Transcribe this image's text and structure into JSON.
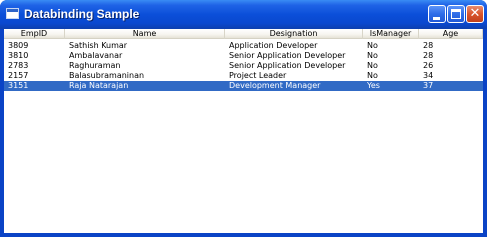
{
  "window": {
    "title": "Databinding Sample",
    "accent": "#0a43c6",
    "selection_color": "#316ac5"
  },
  "controls": {
    "minimize_icon": "minimize-icon",
    "maximize_icon": "maximize-icon",
    "close_icon": "close-icon",
    "close_glyph": "✕"
  },
  "table": {
    "columns": [
      "EmpID",
      "Name",
      "Designation",
      "IsManager",
      "Age"
    ],
    "rows": [
      [
        "3809",
        "Sathish Kumar",
        "Application Developer",
        "No",
        "28"
      ],
      [
        "3810",
        "Ambalavanar",
        "Senior Application Developer",
        "No",
        "28"
      ],
      [
        "2783",
        "Raghuraman",
        "Senior Application Developer",
        "No",
        "26"
      ],
      [
        "2157",
        "Balasubramaninan",
        "Project Leader",
        "No",
        "34"
      ],
      [
        "3151",
        "Raja Natarajan",
        "Development Manager",
        "Yes",
        "37"
      ]
    ],
    "selected_row": 4
  }
}
